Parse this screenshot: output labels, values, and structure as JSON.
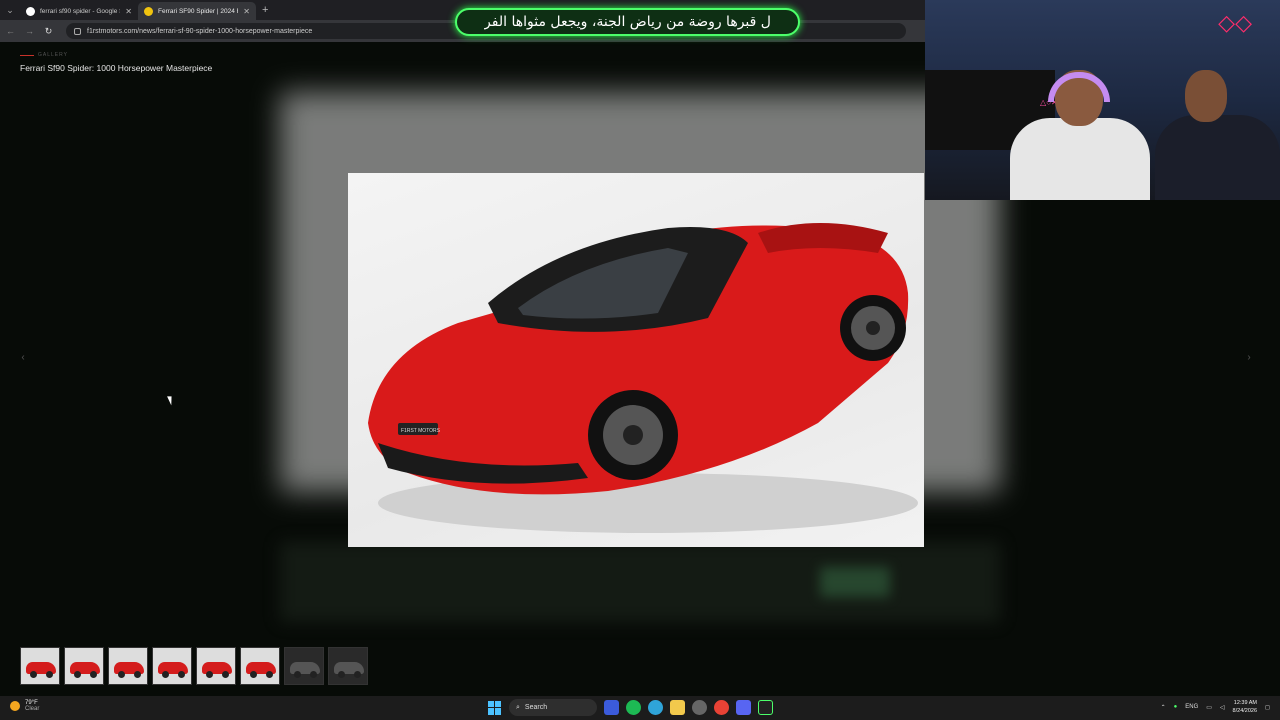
{
  "browser": {
    "tabs": [
      {
        "label": "ferrari sf90 spider - Google Sea",
        "favicon_color": "#ffffff",
        "active": false
      },
      {
        "label": "Ferrari SF90 Spider | 2024 Revie",
        "favicon_color": "#f1c40f",
        "active": true
      }
    ],
    "new_tab": "+",
    "url": "f1rstmotors.com/news/ferrari-sf-90-spider-1000-horsepower-masterpiece"
  },
  "gallery": {
    "tag": "GALLERY",
    "title": "Ferrari Sf90 Spider: 1000 Horsepower Masterpiece",
    "prev_arrow": "‹",
    "next_arrow": "›",
    "plate_text": "F1RST MOTORS",
    "thumbnail_count": 8
  },
  "overlay": {
    "subtitle": "ل قبرها روضة من رياض الجنة، ويجعل مثواها الفر",
    "accent": "#4cff6a"
  },
  "taskbar": {
    "temperature": "79°F",
    "condition": "Clear",
    "search_label": "Search",
    "language": "ENG",
    "time": "12:39 AM",
    "date": "8/24/2026"
  }
}
